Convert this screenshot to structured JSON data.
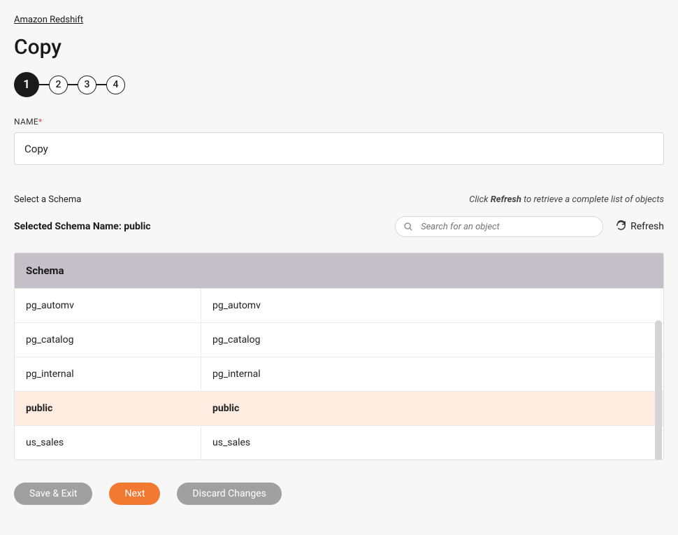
{
  "breadcrumb": "Amazon Redshift",
  "page_title": "Copy",
  "stepper": {
    "steps": [
      "1",
      "2",
      "3",
      "4"
    ],
    "active_index": 0
  },
  "name_field": {
    "label": "NAME",
    "value": "Copy"
  },
  "schema_section": {
    "select_label": "Select a Schema",
    "refresh_hint_prefix": "Click ",
    "refresh_hint_bold": "Refresh",
    "refresh_hint_suffix": " to retrieve a complete list of objects",
    "selected_line": "Selected Schema Name: public",
    "search_placeholder": "Search for an object",
    "refresh_label": "Refresh"
  },
  "table": {
    "header": "Schema",
    "rows": [
      {
        "col1": "pg_automv",
        "col2": "pg_automv",
        "selected": false
      },
      {
        "col1": "pg_catalog",
        "col2": "pg_catalog",
        "selected": false
      },
      {
        "col1": "pg_internal",
        "col2": "pg_internal",
        "selected": false
      },
      {
        "col1": "public",
        "col2": "public",
        "selected": true
      },
      {
        "col1": "us_sales",
        "col2": "us_sales",
        "selected": false
      }
    ]
  },
  "footer": {
    "save_exit": "Save & Exit",
    "next": "Next",
    "discard": "Discard Changes"
  }
}
